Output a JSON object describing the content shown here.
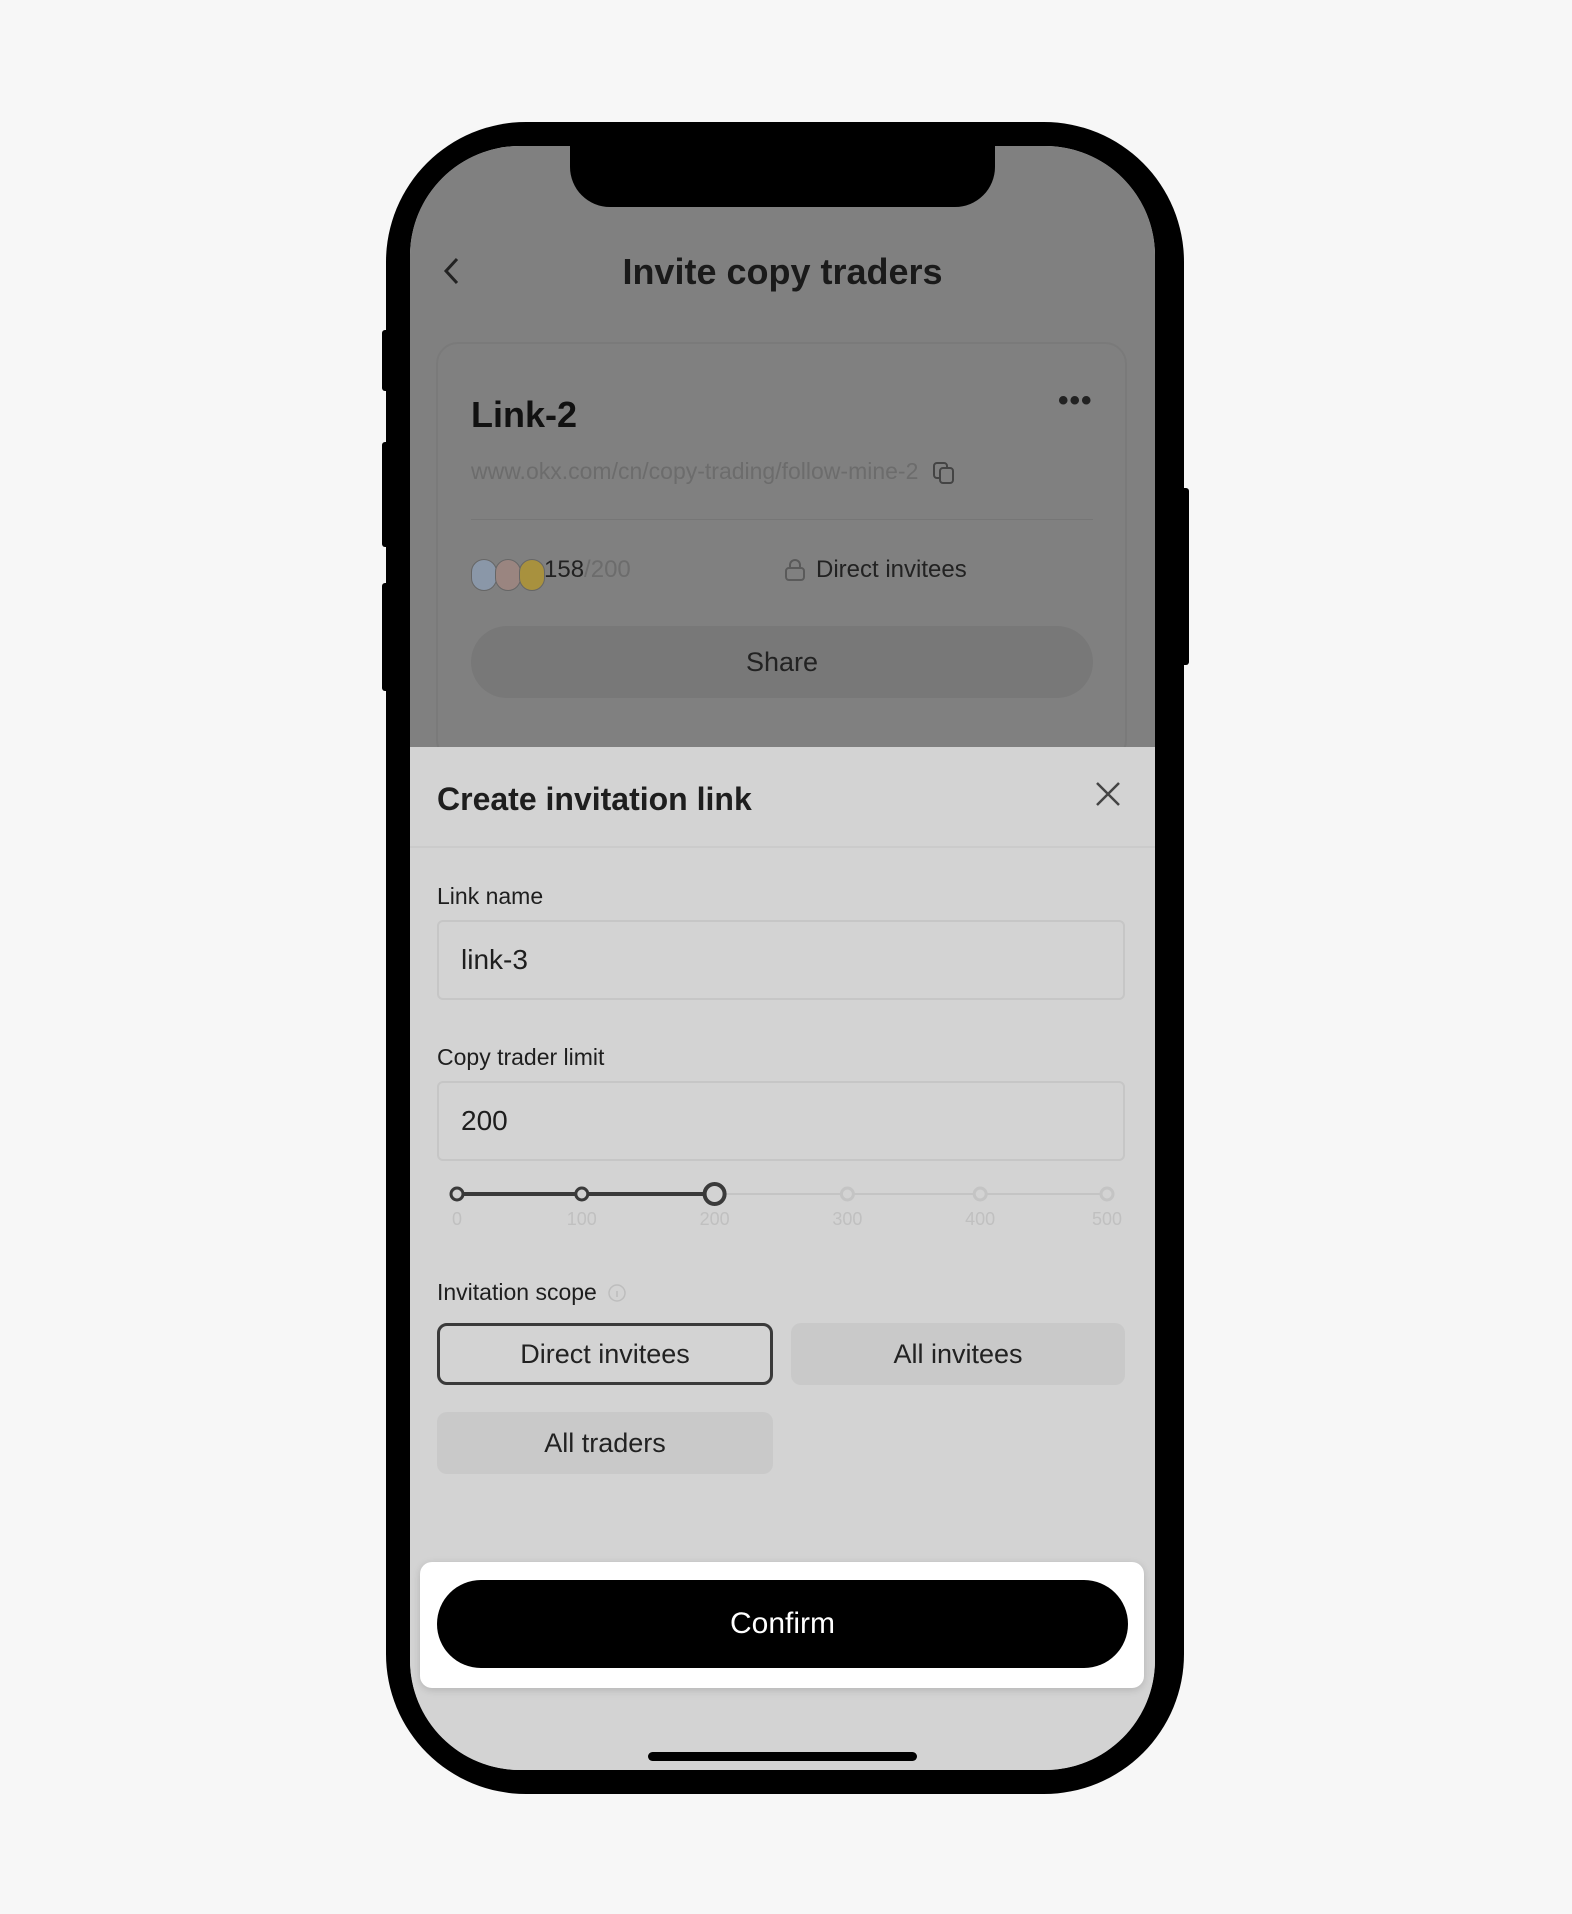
{
  "header": {
    "title": "Invite copy traders",
    "back_icon": "chevron-left-icon"
  },
  "link_card": {
    "name": "Link-2",
    "url": "www.okx.com/cn/copy-trading/follow-mine-2",
    "followers": "158",
    "limit": "/200",
    "scope": "Direct invitees",
    "share_label": "Share"
  },
  "sheet": {
    "title": "Create invitation link",
    "link_name_label": "Link name",
    "link_name_value": "link-3",
    "limit_label": "Copy trader limit",
    "limit_value": "200",
    "slider": {
      "ticks": [
        "0",
        "100",
        "200",
        "300",
        "400",
        "500"
      ],
      "value": 200,
      "max": 500
    },
    "scope_label": "Invitation scope",
    "scope_options": [
      "Direct invitees",
      "All invitees",
      "All traders"
    ],
    "selected_scope": "Direct invitees",
    "confirm_label": "Confirm"
  },
  "colors": {
    "accent": "#000000",
    "overlay": "#808080"
  }
}
